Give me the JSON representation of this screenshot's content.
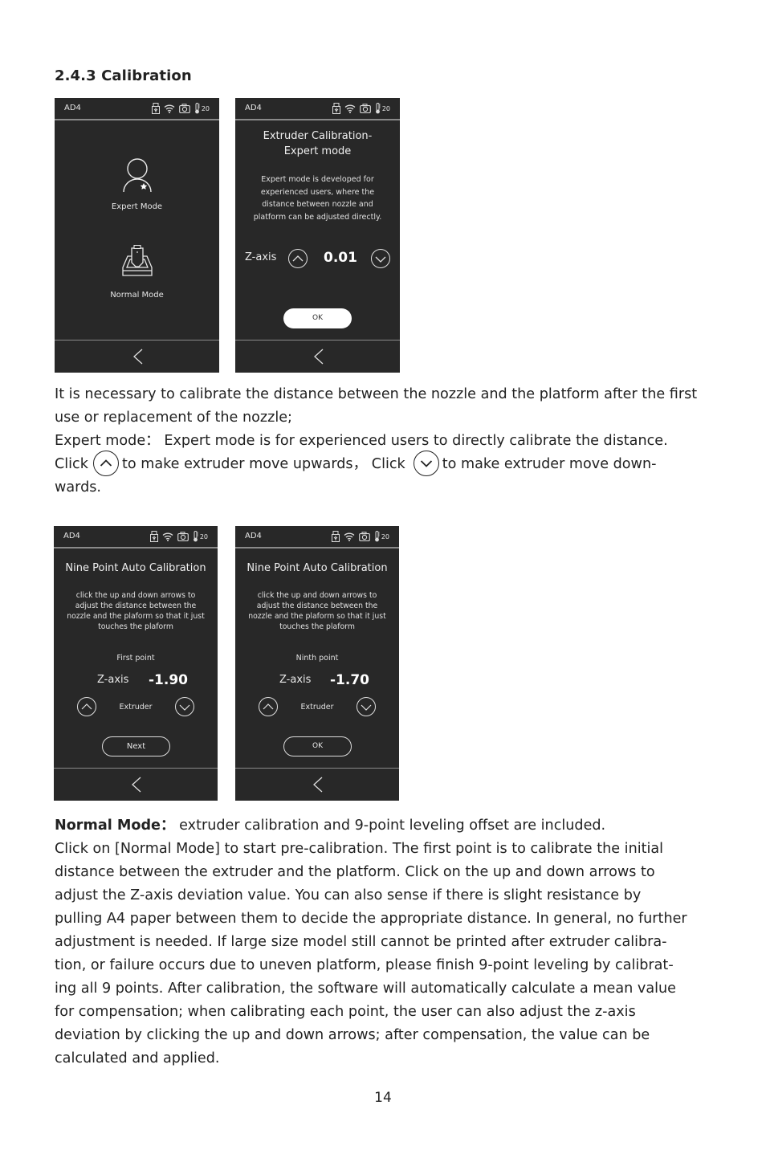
{
  "section": {
    "heading": "2.4.3 Calibration"
  },
  "status_bar": {
    "model": "AD4",
    "icons": [
      "usb-storage-icon",
      "wifi-icon",
      "camera-icon",
      "thermometer-icon"
    ],
    "temperature": "20"
  },
  "screens": {
    "mode_select": {
      "expert_label": "Expert Mode",
      "normal_label": "Normal Mode"
    },
    "expert": {
      "title_line1": "Extruder Calibration-",
      "title_line2": "Expert mode",
      "desc_lines": [
        "Expert mode is developed for",
        "experienced users, where the",
        "distance between nozzle and",
        "platform can be adjusted directly."
      ],
      "z_label": "Z-axis",
      "z_value": "0.01",
      "ok_label": "OK"
    },
    "nine_point_first": {
      "title": "Nine Point Auto Calibration",
      "desc_lines": [
        "click the up and down arrows to",
        "adjust the distance between the",
        "nozzle and the plaform so that it just",
        "touches the plaform"
      ],
      "point_label": "First point",
      "z_label": "Z-axis",
      "z_value": "-1.90",
      "extruder_label": "Extruder",
      "button_label": "Next"
    },
    "nine_point_ninth": {
      "title": "Nine Point Auto Calibration",
      "desc_lines": [
        "click the up and down arrows to",
        "adjust the distance between the",
        "nozzle and the plaform so that it just",
        "touches the plaform"
      ],
      "point_label": "Ninth point",
      "z_label": "Z-axis",
      "z_value": "-1.70",
      "extruder_label": "Extruder",
      "button_label": "OK"
    }
  },
  "paragraph1": {
    "line1": "It is necessary to calibrate the distance between the nozzle and the platform after the first",
    "line2": "use or replacement of the nozzle;",
    "line3": "Expert mode： Expert mode is for experienced users to directly calibrate the distance.",
    "line4_a": "Click",
    "line4_b": "to make extruder move upwards， Click",
    "line4_c": "to make extruder move down-",
    "line5": "wards."
  },
  "paragraph2": {
    "bold_lead": "Normal Mode：",
    "line1_rest": " extruder calibration and 9-point leveling offset are included.",
    "lines": [
      "Click on [Normal Mode] to start pre-calibration. The first point is to calibrate the initial",
      "distance between the extruder and the platform. Click on the up and down arrows to",
      "adjust the Z-axis deviation value. You can also sense if there is slight resistance by",
      "pulling A4 paper between them to decide the appropriate distance. In general, no further",
      "adjustment is needed. If large size model still cannot be printed after extruder calibra-",
      "tion, or failure occurs due to uneven platform, please finish 9-point leveling by calibrat-",
      "ing all 9 points. After calibration, the software will automatically calculate a mean value",
      "for compensation; when calibrating each point, the user can also adjust the z-axis",
      "deviation by clicking the up and down arrows; after compensation, the value can be",
      "calculated and applied."
    ]
  },
  "page_number": "14"
}
